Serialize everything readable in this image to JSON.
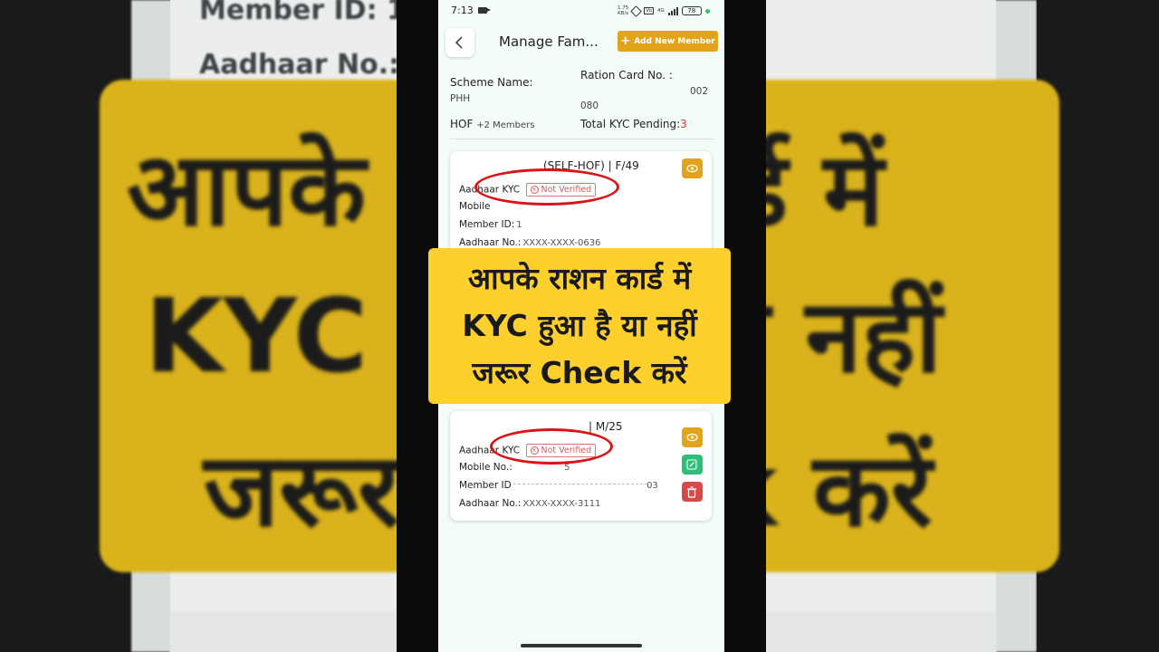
{
  "background": {
    "member_id_text": "Member ID: 1",
    "aadhaar_text": "Aadhaar No.:",
    "big_line1": "आपके राशन कार्ड में",
    "big_line2": "KYC हुआ है या नहीं",
    "big_line3": "जरूर Check करें"
  },
  "status_bar": {
    "time": "7:13",
    "speed_value": "1.75",
    "speed_unit": "KB/s",
    "network": "4G",
    "battery": "78"
  },
  "header": {
    "title": "Manage Fam...",
    "add_member_label": "Add New Member"
  },
  "summary": {
    "scheme_label": "Scheme Name:",
    "scheme_value": "PHH",
    "ration_card_label": "Ration Card No. :",
    "ration_card_value_suffix": "002",
    "ration_card_value_line2": "080",
    "hof_label": "HOF",
    "members_text": "+2 Members",
    "kyc_pending_label": "Total KYC Pending:",
    "kyc_pending_value": "3"
  },
  "members": [
    {
      "heading": "(SELF-HOF) | F/49",
      "kyc_label": "Aadhaar KYC",
      "kyc_status": "Not Verified",
      "mobile_label": "Mobile",
      "member_id_label": "Member ID:",
      "member_id_value": "1",
      "aadhaar_label": "Aadhaar No.:",
      "aadhaar_value": "XXXX-XXXX-0636"
    },
    {
      "heading": "| M/25",
      "kyc_label": "Aadhaar KYC",
      "kyc_status": "Not Verified",
      "mobile_label": "Mobile No.:",
      "mobile_value_tail": "5",
      "member_id_label": "Member ID",
      "member_id_value_tail": "03",
      "aadhaar_label": "Aadhaar No.:",
      "aadhaar_value": "XXXX-XXXX-3111"
    }
  ],
  "banner": {
    "line1": "आपके राशन कार्ड में",
    "line2": "KYC हुआ है या नहीं",
    "line3": "जरूर Check करें"
  },
  "colors": {
    "accent": "#e2a41b",
    "banner_yellow": "#fdd02e",
    "edit_green": "#2bbf78",
    "delete_red": "#d84a4a",
    "highlight_red": "#d81414"
  }
}
